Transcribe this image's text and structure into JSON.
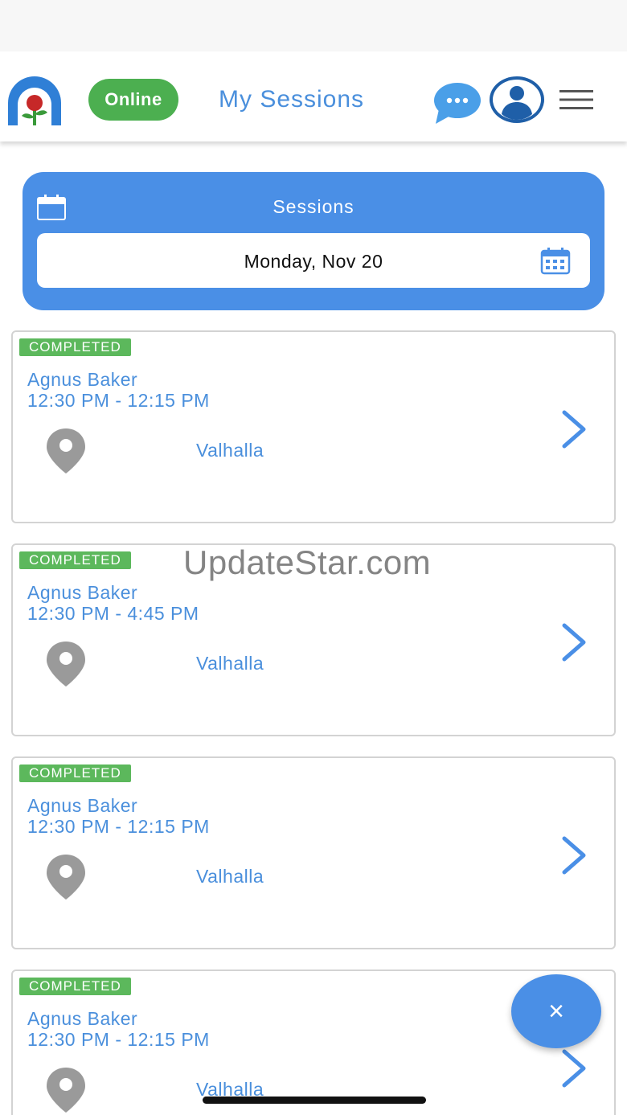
{
  "header": {
    "status": "Online",
    "title": "My Sessions"
  },
  "sessions_panel": {
    "title": "Sessions",
    "date": "Monday, Nov 20"
  },
  "sessions": [
    {
      "status": "COMPLETED",
      "client": "Agnus Baker",
      "time": "12:30 PM - 12:15 PM",
      "location": "Valhalla"
    },
    {
      "status": "COMPLETED",
      "client": "Agnus Baker",
      "time": "12:30 PM - 4:45 PM",
      "location": "Valhalla"
    },
    {
      "status": "COMPLETED",
      "client": "Agnus Baker",
      "time": "12:30 PM - 12:15 PM",
      "location": "Valhalla"
    },
    {
      "status": "COMPLETED",
      "client": "Agnus Baker",
      "time": "12:30 PM - 12:15 PM",
      "location": "Valhalla"
    }
  ],
  "fab": {
    "icon": "close-icon",
    "label": "×"
  },
  "watermark": "UpdateStar.com",
  "colors": {
    "accent": "#4a8fe6",
    "text_blue": "#4a8fdc",
    "online_green": "#4caf50",
    "badge_green": "#5cb85c"
  }
}
